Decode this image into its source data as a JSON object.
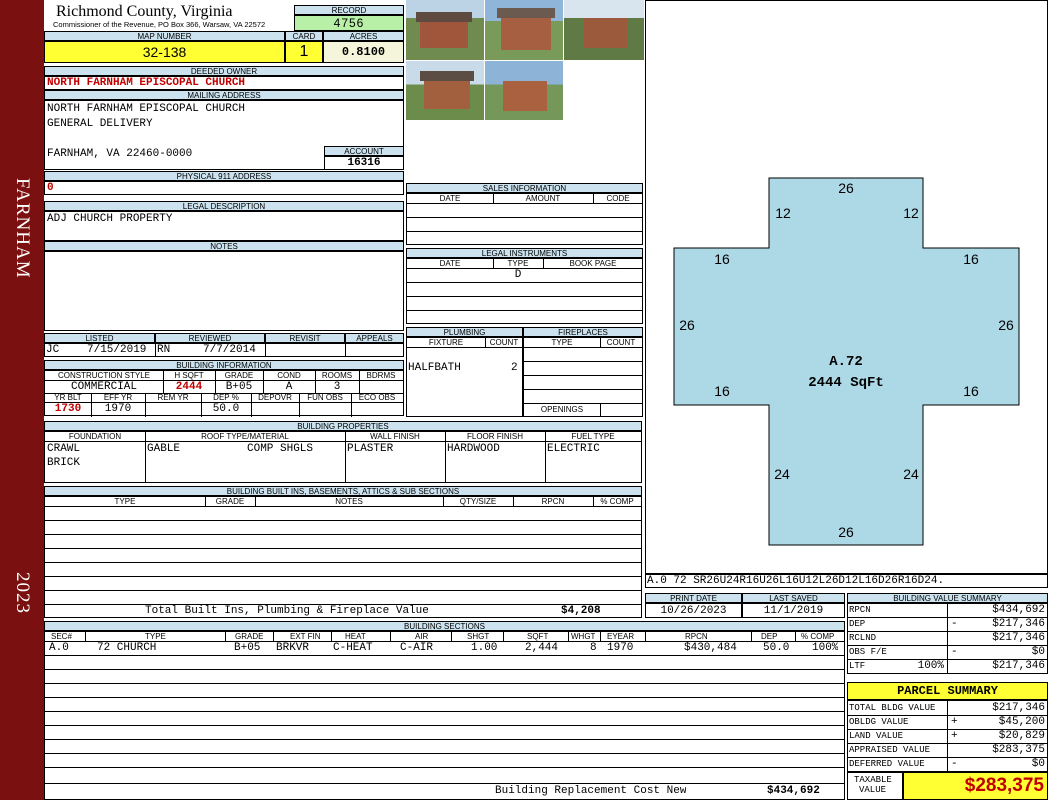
{
  "sidebar": {
    "name": "FARNHAM",
    "year": "2023"
  },
  "header": {
    "county": "Richmond County, Virginia",
    "office": "Commissioner of the Revenue, PO Box 366, Warsaw, VA 22572",
    "record_label": "RECORD",
    "record_value": "4756",
    "map_label": "MAP NUMBER",
    "map_value": "32-138",
    "card_label": "CARD",
    "card_value": "1",
    "acres_label": "ACRES",
    "acres_value": "0.8100"
  },
  "owner": {
    "deeded_label": "DEEDED OWNER",
    "deeded_value": "NORTH FARNHAM EPISCOPAL CHURCH",
    "mailing_label": "MAILING ADDRESS",
    "mailing_lines": [
      "NORTH FARNHAM EPISCOPAL CHURCH",
      "GENERAL DELIVERY",
      "",
      "FARNHAM, VA 22460-0000"
    ],
    "account_label": "ACCOUNT",
    "account_value": "16316",
    "physical_label": "PHYSICAL 911 ADDRESS",
    "physical_value": "0",
    "legal_label": "LEGAL DESCRIPTION",
    "legal_value": "ADJ CHURCH PROPERTY",
    "notes_label": "NOTES"
  },
  "review": {
    "listed_label": "LISTED",
    "reviewed_label": "REVIEWED",
    "revisit_label": "REVISIT",
    "appeals_label": "APPEALS",
    "listed_by": "JC",
    "listed_date": "7/15/2019",
    "reviewed_by": "RN",
    "reviewed_date": "7/7/2014"
  },
  "building_info": {
    "title": "BUILDING INFORMATION",
    "headers": [
      "CONSTRUCTION STYLE",
      "H SQFT",
      "GRADE",
      "COND",
      "ROOMS",
      "BDRMS"
    ],
    "values": [
      "COMMERCIAL",
      "2444",
      "B+05",
      "A",
      "3",
      ""
    ],
    "headers2": [
      "YR BLT",
      "EFF YR",
      "REM YR",
      "DEP %",
      "DEPOVR",
      "FUN OBS",
      "ECO OBS"
    ],
    "values2": [
      "1730",
      "1970",
      "",
      "50.0",
      "",
      "",
      ""
    ]
  },
  "sales": {
    "title": "SALES INFORMATION",
    "headers": [
      "DATE",
      "AMOUNT",
      "CODE"
    ]
  },
  "legal_instruments": {
    "title": "LEGAL INSTRUMENTS",
    "headers": [
      "DATE",
      "TYPE",
      "BOOK PAGE"
    ],
    "row1_type": "D"
  },
  "plumbing": {
    "title": "PLUMBING",
    "headers": [
      "FIXTURE",
      "COUNT"
    ],
    "fixture": "HALFBATH",
    "count": "2"
  },
  "fireplaces": {
    "title": "FIREPLACES",
    "headers": [
      "TYPE",
      "COUNT"
    ],
    "openings_label": "OPENINGS"
  },
  "properties": {
    "title": "BUILDING PROPERTIES",
    "headers": [
      "FOUNDATION",
      "ROOF TYPE/MATERIAL",
      "WALL FINISH",
      "FLOOR FINISH",
      "FUEL TYPE"
    ],
    "foundation": [
      "CRAWL",
      "BRICK"
    ],
    "roof_type": "GABLE",
    "roof_material": "COMP SHGLS",
    "wall": "PLASTER",
    "floor": "HARDWOOD",
    "fuel": "ELECTRIC"
  },
  "builtins": {
    "title": "BUILDING BUILT INS, BASEMENTS, ATTICS & SUB SECTIONS",
    "headers": [
      "TYPE",
      "GRADE",
      "NOTES",
      "QTY/SIZE",
      "RPCN",
      "% COMP"
    ],
    "total_label": "Total Built Ins, Plumbing & Fireplace Value",
    "total_value": "$4,208"
  },
  "sketch": {
    "area_label": "A.72",
    "sqft_label": "2444 SqFt",
    "dims": {
      "top": "26",
      "ul": "12",
      "ur": "12",
      "l1": "16",
      "r1": "16",
      "left": "26",
      "right": "26",
      "l2": "16",
      "r2": "16",
      "ll": "24",
      "lr": "24",
      "bottom": "26"
    },
    "code_line": "A.0  72   SR26U24R16U26L16U12L26D12L16D26R16D24."
  },
  "dates": {
    "print_label": "PRINT DATE",
    "print_value": "10/26/2023",
    "saved_label": "LAST SAVED",
    "saved_value": "11/1/2019"
  },
  "sections": {
    "title": "BUILDING SECTIONS",
    "headers": [
      "SEC#",
      "TYPE",
      "GRADE",
      "EXT FIN",
      "HEAT",
      "AIR",
      "SHGT",
      "SQFT",
      "WHGT",
      "EYEAR",
      "RPCN",
      "DEP",
      "% COMP"
    ],
    "row": [
      "A.0",
      "72 CHURCH",
      "B+05",
      "BRKVR",
      "C-HEAT",
      "C-AIR",
      "1.00",
      "2,444",
      "8",
      "1970",
      "$430,484",
      "50.0",
      "100%"
    ],
    "replacement_label": "Building Replacement Cost New",
    "replacement_value": "$434,692"
  },
  "value_summary": {
    "title": "BUILDING VALUE SUMMARY",
    "rows": [
      {
        "label": "RPCN",
        "sign": "",
        "value": "$434,692"
      },
      {
        "label": "DEP",
        "sign": "-",
        "value": "$217,346"
      },
      {
        "label": "RCLND",
        "sign": "",
        "value": "$217,346"
      },
      {
        "label": "OBS F/E",
        "sign": "-",
        "value": "$0"
      },
      {
        "label": "LTF",
        "sign": "100%",
        "value": "$217,346"
      }
    ]
  },
  "parcel": {
    "title": "PARCEL SUMMARY",
    "rows": [
      {
        "label": "TOTAL BLDG VALUE",
        "sign": "",
        "value": "$217,346"
      },
      {
        "label": "OBLDG VALUE",
        "sign": "+",
        "value": "$45,200"
      },
      {
        "label": "LAND VALUE",
        "sign": "+",
        "value": "$20,829"
      },
      {
        "label": "APPRAISED VALUE",
        "sign": "",
        "value": "$283,375"
      },
      {
        "label": "DEFERRED VALUE",
        "sign": "-",
        "value": "$0"
      }
    ],
    "taxable_label_1": "TAXABLE",
    "taxable_label_2": "VALUE",
    "taxable_value": "$283,375"
  },
  "photos": {
    "alt": [
      "church-photo-1",
      "church-photo-2",
      "church-photo-3",
      "church-photo-4",
      "church-photo-5"
    ]
  }
}
